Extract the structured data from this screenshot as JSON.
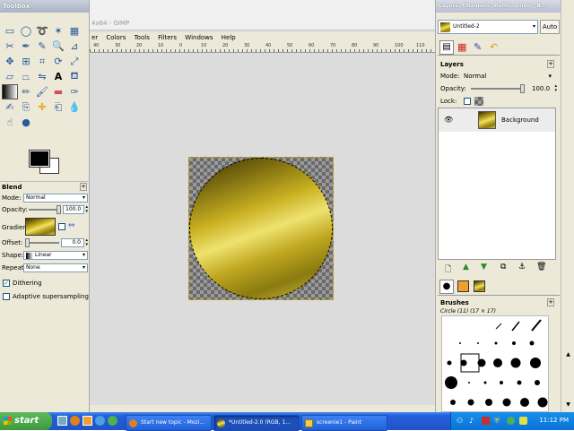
{
  "toolbox": {
    "title": "Toolbox",
    "tools": [
      "rect-select",
      "ellipse-select",
      "free-select",
      "fuzzy-select",
      "color-select",
      "scissors",
      "paths",
      "color-picker",
      "zoom",
      "measure",
      "move",
      "align",
      "crop",
      "rotate",
      "scale",
      "shear",
      "perspective",
      "flip",
      "text",
      "bucket-fill",
      "blend",
      "pencil",
      "paintbrush",
      "eraser",
      "airbrush",
      "ink",
      "clone",
      "heal",
      "perspective-clone",
      "blur",
      "smudge",
      "dodge"
    ],
    "fg_color": "#000000",
    "bg_color": "#ffffff"
  },
  "blend": {
    "title": "Blend",
    "mode_label": "Mode:",
    "mode_value": "Normal",
    "opacity_label": "Opacity:",
    "opacity_value": "100.0",
    "opacity_fraction": 1.0,
    "gradient_label": "Gradient:",
    "offset_label": "Offset:",
    "offset_value": "0.0",
    "offset_fraction": 0.0,
    "shape_label": "Shape:",
    "shape_value": "Linear",
    "repeat_label": "Repeat:",
    "repeat_value": "None",
    "dithering_label": "Dithering",
    "dithering_checked": true,
    "adaptive_label": "Adaptive supersampling",
    "adaptive_checked": false
  },
  "image_window": {
    "title": "4x64 - GIMP",
    "menu": [
      "er",
      "Colors",
      "Tools",
      "Filters",
      "Windows",
      "Help"
    ],
    "ruler_ticks": [
      "40",
      "30",
      "20",
      "10",
      "0",
      "10",
      "20",
      "30",
      "40",
      "50",
      "60",
      "70",
      "80",
      "90",
      "100",
      "110"
    ]
  },
  "layers": {
    "title": "Layers, Channels, Paths, Undo - B...",
    "image_select": "Untitled-2",
    "auto_label": "Auto",
    "panel_title": "Layers",
    "mode_label": "Mode:",
    "mode_value": "Normal",
    "opacity_label": "Opacity:",
    "opacity_value": "100.0",
    "opacity_fraction": 1.0,
    "lock_label": "Lock:",
    "layer_name": "Background"
  },
  "brushes": {
    "panel_title": "Brushes",
    "selected_brush": "Circle (11) (17 × 17)"
  },
  "taskbar": {
    "start_label": "start",
    "tasks": [
      "Start new topic - Mozi...",
      "*Untitled-2.0 (RGB, 1...",
      "screenie1 - Paint"
    ],
    "clock": "11:12 PM"
  },
  "colors": {
    "xp_blue": "#245edb",
    "start_green": "#3c9a3c"
  }
}
